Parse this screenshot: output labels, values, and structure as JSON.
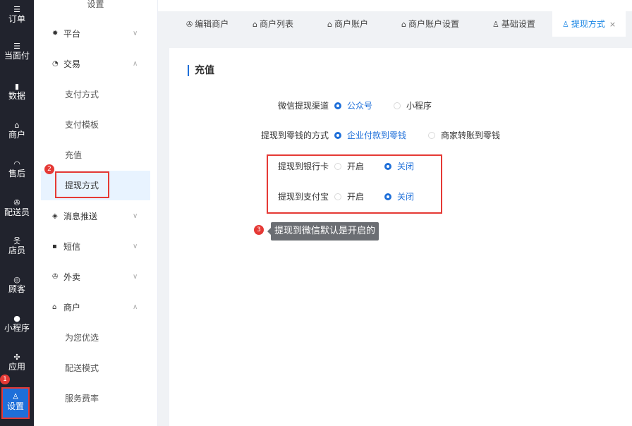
{
  "rail": [
    {
      "label": "订单",
      "icon": "list-icon"
    },
    {
      "label": "当面付",
      "icon": "list-icon"
    },
    {
      "label": "数据",
      "icon": "bar-chart-icon"
    },
    {
      "label": "商户",
      "icon": "store-icon"
    },
    {
      "label": "售后",
      "icon": "headset-icon"
    },
    {
      "label": "配送员",
      "icon": "scooter-icon"
    },
    {
      "label": "店员",
      "icon": "users-icon"
    },
    {
      "label": "顾客",
      "icon": "customer-icon"
    },
    {
      "label": "小程序",
      "icon": "wechat-icon"
    },
    {
      "label": "应用",
      "icon": "apps-icon"
    },
    {
      "label": "设置",
      "icon": "settings-user-icon"
    }
  ],
  "submenu": {
    "title": "设置",
    "platform": "平台",
    "trade": "交易",
    "pay_method": "支付方式",
    "pay_template": "支付模板",
    "recharge": "充值",
    "withdraw": "提现方式",
    "push": "消息推送",
    "sms": "短信",
    "takeout": "外卖",
    "merchant": "商户",
    "preferred": "为您优选",
    "delivery_mode": "配送模式",
    "service_fee": "服务费率"
  },
  "tabs": [
    {
      "label": "编辑商户",
      "icon": "scooter-icon"
    },
    {
      "label": "商户列表",
      "icon": "store-icon"
    },
    {
      "label": "商户账户",
      "icon": "store-icon"
    },
    {
      "label": "商户账户设置",
      "icon": "store-icon"
    },
    {
      "label": "基础设置",
      "icon": "user-icon"
    },
    {
      "label": "提现方式",
      "icon": "user-icon",
      "close": "×"
    }
  ],
  "panel": {
    "title": "充值",
    "wechat_channel": {
      "label": "微信提现渠道",
      "opt1": "公众号",
      "opt2": "小程序"
    },
    "change_method": {
      "label": "提现到零钱的方式",
      "opt1": "企业付款到零钱",
      "opt2": "商家转账到零钱"
    },
    "bank_card": {
      "label": "提现到银行卡",
      "opt1": "开启",
      "opt2": "关闭"
    },
    "alipay": {
      "label": "提现到支付宝",
      "opt1": "开启",
      "opt2": "关闭"
    }
  },
  "annotations": {
    "b1": "1",
    "b2": "2",
    "b3": "3",
    "tooltip": "提现到微信默认是开启的"
  },
  "colors": {
    "accent": "#1e6fd9",
    "highlight": "#e53935",
    "rail_bg": "#21232d"
  }
}
